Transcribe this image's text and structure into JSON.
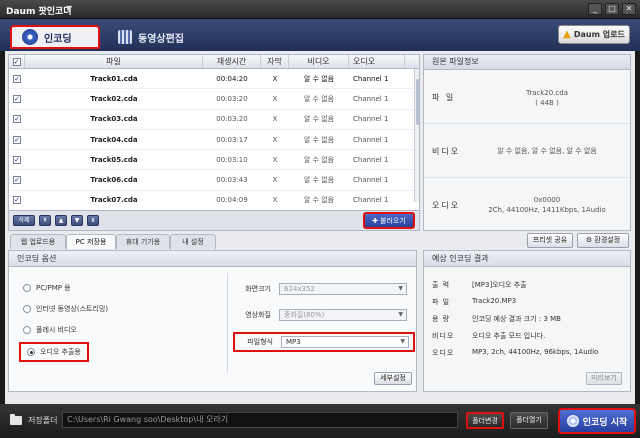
{
  "window": {
    "title": "Daum 팟인코더",
    "caret": "▼",
    "buttons": [
      "_",
      "□",
      "✕"
    ]
  },
  "main_tabs": {
    "encoding": "인코딩",
    "video_edit": "동영상편집"
  },
  "daum_update": "Daum 업로드",
  "file_table": {
    "columns": {
      "file": "파일",
      "duration": "재생시간",
      "subtitle": "자막",
      "video": "비디오",
      "audio": "오디오"
    },
    "rows": [
      {
        "file": "Track01.cda",
        "duration": "00:04:20",
        "subtitle": "X",
        "video": "알 수 없음",
        "audio": "Channel 1"
      },
      {
        "file": "Track02.cda",
        "duration": "00:03:20",
        "subtitle": "X",
        "video": "알 수 없음",
        "audio": "Channel 1"
      },
      {
        "file": "Track03.cda",
        "duration": "00:03:20",
        "subtitle": "X",
        "video": "알 수 없음",
        "audio": "Channel 1"
      },
      {
        "file": "Track04.cda",
        "duration": "00:03:17",
        "subtitle": "X",
        "video": "알 수 없음",
        "audio": "Channel 1"
      },
      {
        "file": "Track05.cda",
        "duration": "00:03:10",
        "subtitle": "X",
        "video": "알 수 없음",
        "audio": "Channel 1"
      },
      {
        "file": "Track06.cda",
        "duration": "00:03:43",
        "subtitle": "X",
        "video": "알 수 없음",
        "audio": "Channel 1"
      },
      {
        "file": "Track07.cda",
        "duration": "00:04:09",
        "subtitle": "X",
        "video": "알 수 없음",
        "audio": "Channel 1"
      }
    ]
  },
  "toolbar": {
    "delete": "삭제",
    "load": "불러오기"
  },
  "source_info": {
    "heading": "원본 파일정보",
    "file_label": "파 일",
    "file_value": "Track20.cda\n( 44B )",
    "video_label": "비디오",
    "video_value": "알 수 없음, 알 수 없음, 알 수 없음",
    "audio_label": "오디오",
    "audio_value": "0x0000\n2Ch, 44100Hz, 1411Kbps, 1Audio"
  },
  "sub_tabs": [
    "웹 업로드용",
    "PC 저장용",
    "휴대 기기용",
    "내 설정"
  ],
  "preset_share": "프리셋 공유",
  "env_settings": "환경설정",
  "encoding_options": {
    "heading": "인코딩 옵션",
    "radios": [
      "PC/PMP 용",
      "인터넷 동영상(스트리밍)",
      "풀레시 비디오",
      "오디오 추출용"
    ],
    "screen_size_label": "화면크기",
    "screen_size_value": "624x352",
    "quality_label": "영상화질",
    "quality_value": "중화질(80%)",
    "format_label": "파일형식",
    "format_value": "MP3",
    "detail_button": "세부설정"
  },
  "result": {
    "heading": "예상 인코딩 결과",
    "rows": [
      {
        "label": "출 력",
        "value": "[MP3]오디오 추출"
      },
      {
        "label": "파 일",
        "value": "Track20.MP3"
      },
      {
        "label": "용 량",
        "value": "인코딩 예상 결과 크기 : 3 MB"
      },
      {
        "label": "비디오",
        "value": "오디오 추출 모드 입니다."
      },
      {
        "label": "오디오",
        "value": "MP3, 2ch, 44100Hz, 96kbps, 1Audio"
      }
    ],
    "preview_button": "미리보기"
  },
  "bottom": {
    "save_folder_label": "저장폴더",
    "path": "C:\\Users\\Ri Gwang soo\\Desktop\\내 오라기",
    "folder_change": "폴더변경",
    "folder_open": "폴더열기",
    "start": "인코딩 시작"
  }
}
